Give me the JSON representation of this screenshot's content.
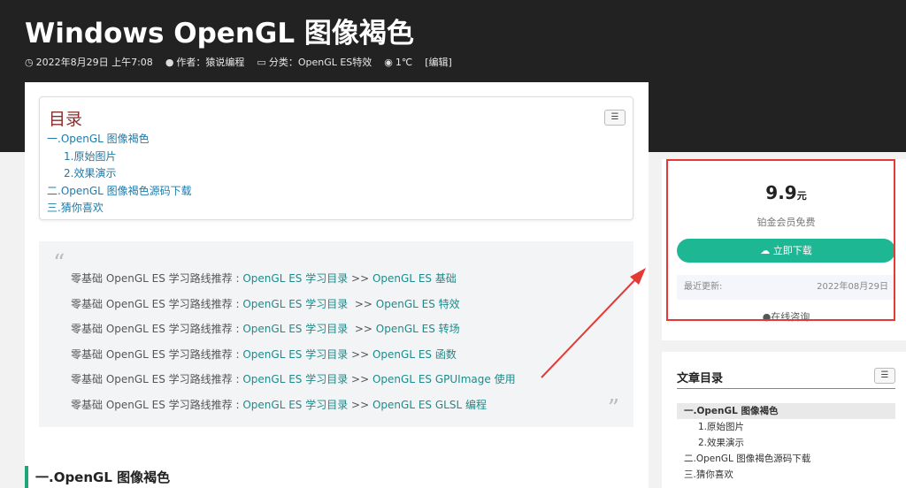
{
  "header": {
    "title": "Windows OpenGL 图像褐色",
    "date": "2022年8月29日 上午7:08",
    "author": "作者：猿说编程",
    "category": "分类：OpenGL ES特效",
    "views": "1℃",
    "edit": "[编辑]"
  },
  "toc": {
    "title": "目录",
    "items": [
      "一.OpenGL 图像褐色",
      "1.原始图片",
      "2.效果演示",
      "二.OpenGL 图像褐色源码下载",
      "三.猜你喜欢"
    ]
  },
  "quote": {
    "lines": [
      {
        "prefix": "零基础 OpenGL ES 学习路线推荐 : ",
        "link1": "OpenGL ES 学习目录",
        "sep": " >> ",
        "link2": "OpenGL ES 基础"
      },
      {
        "prefix": "零基础 OpenGL ES 学习路线推荐 : ",
        "link1": "OpenGL ES 学习目录",
        "sep": "  >> ",
        "link2": "OpenGL ES 特效"
      },
      {
        "prefix": "零基础 OpenGL ES 学习路线推荐 : ",
        "link1": "OpenGL ES 学习目录",
        "sep": "  >> ",
        "link2": "OpenGL ES 转场"
      },
      {
        "prefix": "零基础 OpenGL ES 学习路线推荐 :  ",
        "link1": "OpenGL ES 学习目录",
        "sep": " >> ",
        "link2": "OpenGL ES 函数"
      },
      {
        "prefix": "零基础 OpenGL ES 学习路线推荐 :  ",
        "link1": "OpenGL ES 学习目录",
        "sep": " >> ",
        "link2": "OpenGL ES GPUImage 使用"
      },
      {
        "prefix": "零基础 OpenGL ES 学习路线推荐 :  ",
        "link1": "OpenGL ES 学习目录",
        "sep": " >> ",
        "link2": "OpenGL ES GLSL 编程"
      }
    ]
  },
  "section_heading": "一.OpenGL 图像褐色",
  "download": {
    "price": "9.9",
    "unit": "元",
    "member": "铂金会员免费",
    "button": "立即下载",
    "update_label": "最近更新:",
    "update_date": "2022年08月29日",
    "consult": "在线咨询"
  },
  "article_toc": {
    "title": "文章目录",
    "items": [
      "一.OpenGL 图像褐色",
      "1.原始图片",
      "2.效果演示",
      "二.OpenGL 图像褐色源码下载",
      "三.猜你喜欢"
    ]
  },
  "colors": {
    "accent": "#1db893",
    "annotation": "#e53935",
    "toc_title": "#8b2c2c",
    "link": "#1f8a8a"
  }
}
